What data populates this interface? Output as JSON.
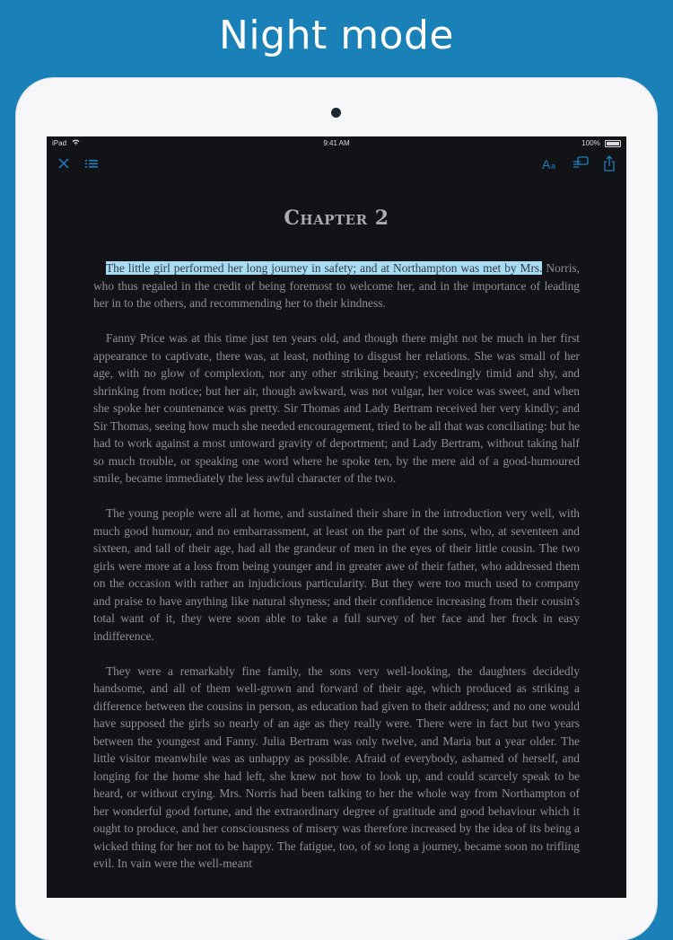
{
  "banner": {
    "title": "Night mode"
  },
  "status_bar": {
    "device": "iPad",
    "time": "9:41 AM",
    "battery": "100%"
  },
  "toolbar": {
    "icons": [
      "close-icon",
      "list-icon",
      "font-size-icon",
      "notes-icon",
      "share-icon"
    ],
    "accent_color": "#1e7fc2"
  },
  "book": {
    "chapter_title": "Chapter 2",
    "highlight_color": "#a9dcf3",
    "p1_highlight": "The little girl performed her long journey in safety; and at Northampton was met by Mrs.",
    "p1_rest": " Norris, who thus regaled in the credit of being foremost to welcome her, and in the importance of leading her in to the others, and recommending her to their kindness.",
    "p2": "Fanny Price was at this time just ten years old, and though there might not be much in her first appearance to captivate, there was, at least, nothing to disgust her relations. She was small of her age, with no glow of complexion, nor any other striking beauty; exceedingly timid and shy, and shrinking from notice; but her air, though awkward, was not vulgar, her voice was sweet, and when she spoke her countenance was pretty. Sir Thomas and Lady Bertram received her very kindly; and Sir Thomas, seeing how much she needed encouragement, tried to be all that was conciliating: but he had to work against a most untoward gravity of deportment; and Lady Bertram, without taking half so much trouble, or speaking one word where he spoke ten, by the mere aid of a good-humoured smile, became immediately the less awful character of the two.",
    "p3": "The young people were all at home, and sustained their share in the introduction very well, with much good humour, and no embarrassment, at least on the part of the sons, who, at seventeen and sixteen, and tall of their age, had all the grandeur of men in the eyes of their little cousin. The two girls were more at a loss from being younger and in greater awe of their father, who addressed them on the occasion with rather an injudicious particularity. But they were too much used to company and praise to have anything like natural shyness; and their confidence increasing from their cousin's total want of it, they were soon able to take a full survey of her face and her frock in easy indifference.",
    "p4": "They were a remarkably fine family, the sons very well-looking, the daughters decidedly handsome, and all of them well-grown and forward of their age, which produced as striking a difference between the cousins in person, as education had given to their address; and no one would have supposed the girls so nearly of an age as they really were. There were in fact but two years between the youngest and Fanny. Julia Bertram was only twelve, and Maria but a year older. The little visitor meanwhile was as unhappy as possible. Afraid of everybody, ashamed of herself, and longing for the home she had left, she knew not how to look up, and could scarcely speak to be heard, or without crying. Mrs. Norris had been talking to her the whole way from Northampton of her wonderful good fortune, and the extraordinary degree of gratitude and good behaviour which it ought to produce, and her consciousness of misery was therefore increased by the idea of its being a wicked thing for her not to be happy. The fatigue, too, of so long a journey, became soon no trifling evil. In vain were the well-meant"
  }
}
